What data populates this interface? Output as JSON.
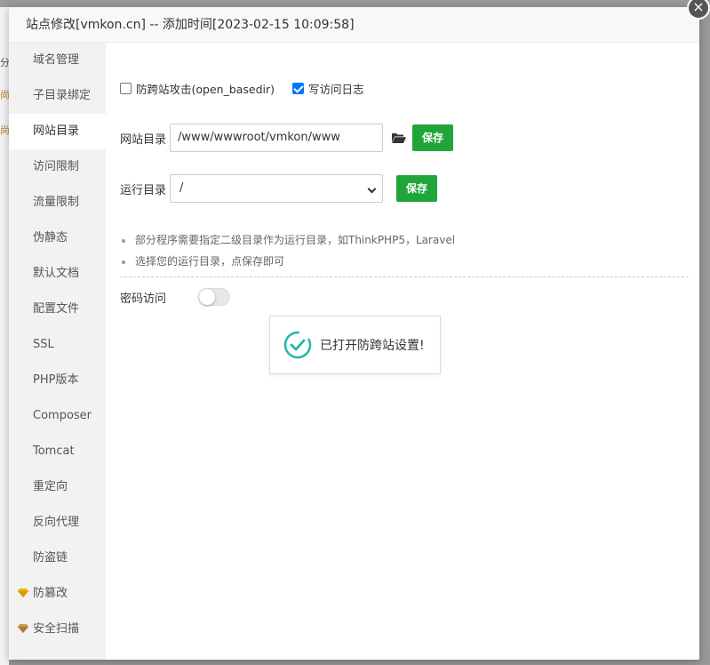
{
  "background": {
    "fragments": [
      "分",
      "尚",
      "尚"
    ]
  },
  "modal": {
    "title": "站点修改[vmkon.cn] -- 添加时间[2023-02-15 10:09:58]",
    "close_label": "×"
  },
  "sidebar": {
    "items": [
      {
        "label": "域名管理",
        "active": false
      },
      {
        "label": "子目录绑定",
        "active": false
      },
      {
        "label": "网站目录",
        "active": true
      },
      {
        "label": "访问限制",
        "active": false
      },
      {
        "label": "流量限制",
        "active": false
      },
      {
        "label": "伪静态",
        "active": false
      },
      {
        "label": "默认文档",
        "active": false
      },
      {
        "label": "配置文件",
        "active": false
      },
      {
        "label": "SSL",
        "active": false
      },
      {
        "label": "PHP版本",
        "active": false
      },
      {
        "label": "Composer",
        "active": false
      },
      {
        "label": "Tomcat",
        "active": false
      },
      {
        "label": "重定向",
        "active": false
      },
      {
        "label": "反向代理",
        "active": false
      },
      {
        "label": "防盗链",
        "active": false
      },
      {
        "label": "防篡改",
        "active": false,
        "icon": "gem-icon",
        "icon_color": "#f0b400"
      },
      {
        "label": "安全扫描",
        "active": false,
        "icon": "gem-icon",
        "icon_color": "#b8863b"
      }
    ]
  },
  "options": {
    "anti_xss_label": "防跨站攻击(open_basedir)",
    "anti_xss_checked": false,
    "write_log_label": "写访问日志",
    "write_log_checked": true
  },
  "site_dir": {
    "label": "网站目录",
    "value": "/www/wwwroot/vmkon/www",
    "folder_icon": "folder-open-icon",
    "save_label": "保存"
  },
  "run_dir": {
    "label": "运行目录",
    "selected": "/",
    "save_label": "保存"
  },
  "tips": [
    "部分程序需要指定二级目录作为运行目录，如ThinkPHP5，Laravel",
    "选择您的运行目录，点保存即可"
  ],
  "password_access": {
    "label": "密码访问",
    "enabled": false
  },
  "toast": {
    "icon": "check-circle-icon",
    "message": "已打开防跨站设置!"
  },
  "colors": {
    "accent_green": "#20a53a",
    "checkbox_blue": "#0075ff",
    "toast_icon": "#23b7a5"
  }
}
